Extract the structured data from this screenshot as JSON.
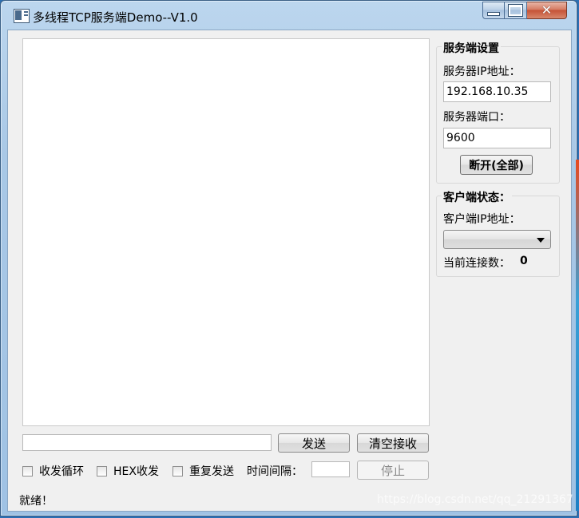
{
  "window": {
    "title": "多线程TCP服务端Demo--V1.0",
    "close_glyph": "✕"
  },
  "receive_area": {
    "value": ""
  },
  "send": {
    "input_value": "",
    "send_label": "发送",
    "clear_label": "清空接收"
  },
  "options": {
    "loop_label": "收发循环",
    "hex_label": "HEX收发",
    "repeat_label": "重复发送",
    "interval_label": "时间间隔：",
    "interval_value": "",
    "stop_label": "停止"
  },
  "server": {
    "group_title": "服务端设置",
    "ip_label": "服务器IP地址：",
    "ip_value": "192.168.10.35",
    "port_label": "服务器端口：",
    "port_value": "9600",
    "disconnect_label": "断开(全部)"
  },
  "client": {
    "group_title": "客户端状态：",
    "ip_label": "客户端IP地址：",
    "selected_ip": "",
    "count_label": "当前连接数：",
    "count_value": "0"
  },
  "status": {
    "text": "就绪！"
  },
  "watermark": "https://blog.csdn.net/qq_21291367"
}
